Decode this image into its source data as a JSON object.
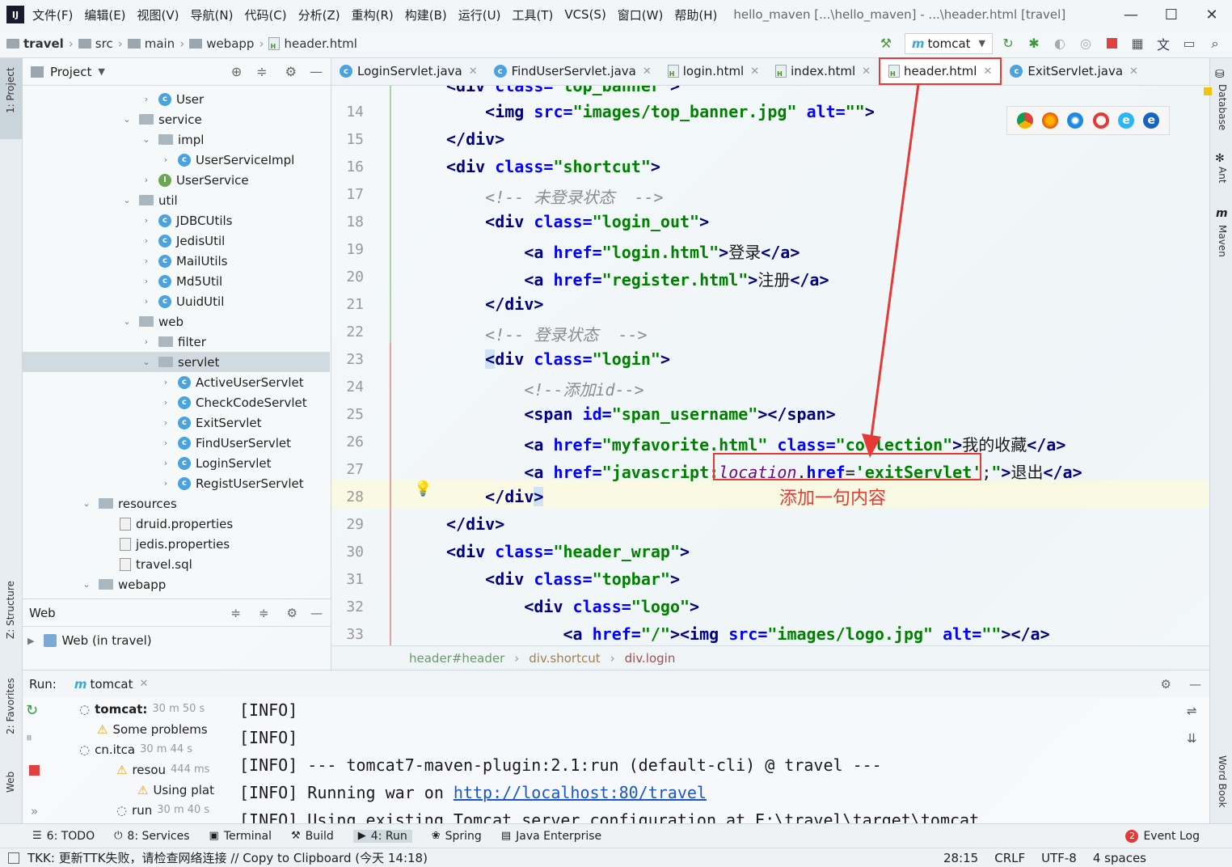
{
  "menubar": {
    "items": [
      "文件(F)",
      "编辑(E)",
      "视图(V)",
      "导航(N)",
      "代码(C)",
      "分析(Z)",
      "重构(R)",
      "构建(B)",
      "运行(U)",
      "工具(T)",
      "VCS(S)",
      "窗口(W)",
      "帮助(H)"
    ],
    "window_title": "hello_maven [...\\hello_maven] - ...\\header.html [travel]"
  },
  "navbar": {
    "crumbs": [
      "travel",
      "src",
      "main",
      "webapp",
      "header.html"
    ],
    "run_config": "tomcat"
  },
  "project_panel": {
    "title": "Project",
    "tree": [
      {
        "label": "User",
        "icon": "class",
        "expanded": false
      },
      {
        "label": "service",
        "icon": "folder",
        "expanded": true
      },
      {
        "label": "impl",
        "icon": "folder",
        "expanded": true
      },
      {
        "label": "UserServiceImpl",
        "icon": "class",
        "expanded": false
      },
      {
        "label": "UserService",
        "icon": "interface",
        "expanded": false
      },
      {
        "label": "util",
        "icon": "folder",
        "expanded": true
      },
      {
        "label": "JDBCUtils",
        "icon": "class",
        "expanded": false
      },
      {
        "label": "JedisUtil",
        "icon": "class",
        "expanded": false
      },
      {
        "label": "MailUtils",
        "icon": "class",
        "expanded": false
      },
      {
        "label": "Md5Util",
        "icon": "class",
        "expanded": false
      },
      {
        "label": "UuidUtil",
        "icon": "class",
        "expanded": false
      },
      {
        "label": "web",
        "icon": "folder",
        "expanded": true
      },
      {
        "label": "filter",
        "icon": "folder",
        "expanded": false
      },
      {
        "label": "servlet",
        "icon": "folder",
        "expanded": true,
        "selected": true
      },
      {
        "label": "ActiveUserServlet",
        "icon": "class",
        "expanded": false
      },
      {
        "label": "CheckCodeServlet",
        "icon": "class",
        "expanded": false
      },
      {
        "label": "ExitServlet",
        "icon": "class",
        "expanded": false
      },
      {
        "label": "FindUserServlet",
        "icon": "class",
        "expanded": false
      },
      {
        "label": "LoginServlet",
        "icon": "class",
        "expanded": false
      },
      {
        "label": "RegistUserServlet",
        "icon": "class",
        "expanded": false
      },
      {
        "label": "resources",
        "icon": "folder",
        "expanded": true
      },
      {
        "label": "druid.properties",
        "icon": "file",
        "expanded": false
      },
      {
        "label": "jedis.properties",
        "icon": "file",
        "expanded": false
      },
      {
        "label": "travel.sql",
        "icon": "file",
        "expanded": false
      },
      {
        "label": "webapp",
        "icon": "folder",
        "expanded": true
      }
    ]
  },
  "web_panel": {
    "title": "Web",
    "item": "Web (in travel)"
  },
  "left_strip": {
    "project": "1: Project",
    "structure": "Z: Structure",
    "favorites": "2: Favorites",
    "web": "Web"
  },
  "right_strip": {
    "database": "Database",
    "ant": "Ant",
    "maven": "Maven",
    "wordbook": "Word Book"
  },
  "tabs": [
    {
      "label": "LoginServlet.java",
      "icon": "class",
      "active": false
    },
    {
      "label": "FindUserServlet.java",
      "icon": "class",
      "active": false
    },
    {
      "label": "login.html",
      "icon": "html",
      "active": false
    },
    {
      "label": "index.html",
      "icon": "html",
      "active": false
    },
    {
      "label": "header.html",
      "icon": "html",
      "active": true
    },
    {
      "label": "ExitServlet.java",
      "icon": "class",
      "active": false
    }
  ],
  "editor": {
    "line_numbers": [
      "14",
      "15",
      "16",
      "17",
      "18",
      "19",
      "20",
      "21",
      "22",
      "23",
      "24",
      "25",
      "26",
      "27",
      "28",
      "29",
      "30",
      "31",
      "32",
      "33"
    ],
    "line13": "<div class=\"top_banner\">",
    "current_line": "28"
  },
  "annotation": {
    "text": "添加一句内容"
  },
  "code_breadcrumb": {
    "a": "header#header",
    "b": "div.shortcut",
    "c": "div.login"
  },
  "run_panel": {
    "label": "Run:",
    "tab": "tomcat",
    "tree": [
      {
        "label": "tomcat:",
        "time": "30 m 50 s"
      },
      {
        "label": "Some problems",
        "time": ""
      },
      {
        "label": "cn.itca",
        "time": "30 m 44 s"
      },
      {
        "label": "resou",
        "time": "444 ms"
      },
      {
        "label": "Using plat",
        "time": ""
      },
      {
        "label": "run",
        "time": "30 m 40 s"
      }
    ],
    "console": [
      "[INFO]",
      "[INFO]",
      "[INFO] --- tomcat7-maven-plugin:2.1:run (default-cli) @ travel ---",
      "[INFO] Running war on ",
      "[INFO] Using existing Tomcat server configuration at E:\\travel\\target\\tomcat"
    ],
    "console_link": "http://localhost:80/travel"
  },
  "bottombar": {
    "items": [
      "6: TODO",
      "8: Services",
      "Terminal",
      "Build",
      "4: Run",
      "Spring",
      "Java Enterprise"
    ],
    "event_log": "Event Log",
    "event_count": "2"
  },
  "statusbar": {
    "message": "TKK: 更新TTK失败，请检查网络连接 // Copy to Clipboard (今天 14:18)",
    "position": "28:15",
    "line_sep": "CRLF",
    "encoding": "UTF-8",
    "indent": "4 spaces"
  },
  "colors": {
    "accent_red": "#e53935",
    "tag": "#000080",
    "attr": "#0000ff",
    "value": "#008000"
  }
}
